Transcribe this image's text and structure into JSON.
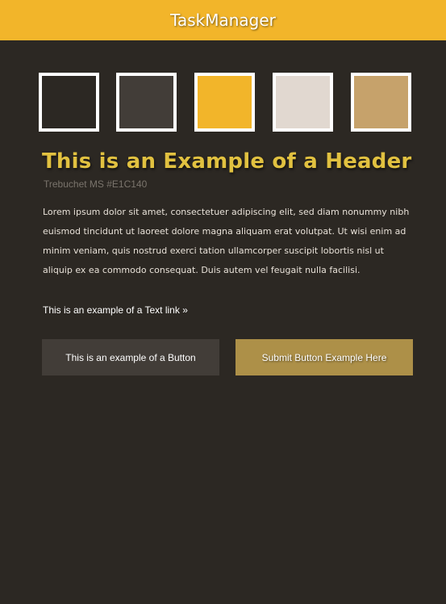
{
  "app": {
    "title": "TaskManager"
  },
  "colors": {
    "topbar": "#f2b52a",
    "background": "#2c2823",
    "header_text": "#e1c140",
    "button_dark": "#423d38",
    "button_gold": "#ad9048"
  },
  "swatches": [
    {
      "name": "dark-brown",
      "color": "#2c2823"
    },
    {
      "name": "charcoal",
      "color": "#423d38"
    },
    {
      "name": "golden-yellow",
      "color": "#f2b52a"
    },
    {
      "name": "light-beige",
      "color": "#e1d8d0"
    },
    {
      "name": "tan",
      "color": "#c6a26b"
    }
  ],
  "content": {
    "header": "This is an Example of a Header",
    "font_note": "Trebuchet MS #E1C140",
    "paragraph": "Lorem ipsum dolor sit amet, consectetuer adipiscing elit, sed diam nonummy nibh euismod tincidunt ut laoreet dolore magna aliquam erat volutpat. Ut wisi enim ad minim veniam, quis nostrud exerci tation ullamcorper suscipit lobortis nisl ut aliquip ex ea commodo consequat. Duis autem vel feugait nulla facilisi.",
    "text_link": "This is an example of a Text link »"
  },
  "buttons": {
    "primary_label": "This is an example of a Button",
    "submit_label": "Submit Button Example Here"
  }
}
